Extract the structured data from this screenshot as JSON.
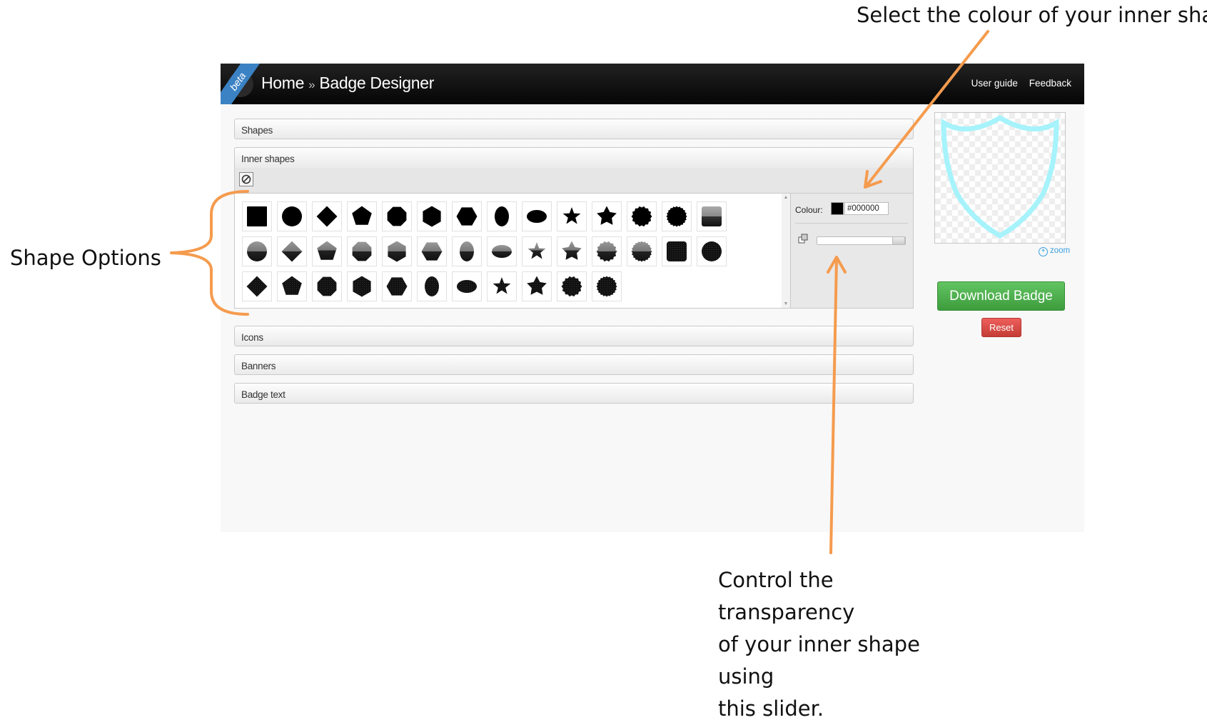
{
  "annotations": {
    "top": "Select the colour of your inner shape",
    "left": "Shape Options",
    "bottom": [
      "Control the transparency",
      "of your inner shape using",
      "this slider."
    ],
    "arrow_color": "#f59b4e"
  },
  "header": {
    "beta": "beta",
    "home": "Home",
    "separator": "»",
    "current": "Badge Designer",
    "links": {
      "user_guide": "User guide",
      "feedback": "Feedback"
    }
  },
  "sections": {
    "shapes": "Shapes",
    "inner_shapes": "Inner shapes",
    "icons": "Icons",
    "banners": "Banners",
    "badge_text": "Badge text"
  },
  "inner_shapes": {
    "rows": [
      [
        "square",
        "circle",
        "diamond",
        "pentagon",
        "octagon",
        "hexagon",
        "hexagon-h",
        "ellipse-v",
        "ellipse-h",
        "star5",
        "star6",
        "seal",
        "seal-fine",
        "square-gradient"
      ],
      [
        "circle-gradient",
        "diamond-gradient",
        "pentagon-gradient",
        "octagon-gradient",
        "hexagon-gradient",
        "hexagon-h-gradient",
        "ellipse-v-gradient",
        "ellipse-h-gradient",
        "star5-gradient",
        "star6-gradient",
        "seal-gradient",
        "seal-fine-gradient",
        "square-texture",
        "circle-texture"
      ],
      [
        "diamond-texture",
        "pentagon-texture",
        "octagon-texture",
        "hexagon-texture",
        "hexagon-h-texture",
        "ellipse-v-texture",
        "ellipse-h-texture",
        "star5-texture",
        "star6-texture",
        "seal-texture",
        "seal-fine-texture"
      ]
    ],
    "colour_label": "Colour:",
    "colour_value": "#000000",
    "opacity": 0.85
  },
  "preview": {
    "outline_color": "#a6f3fb"
  },
  "actions": {
    "zoom": "zoom",
    "download": "Download Badge",
    "reset": "Reset"
  }
}
